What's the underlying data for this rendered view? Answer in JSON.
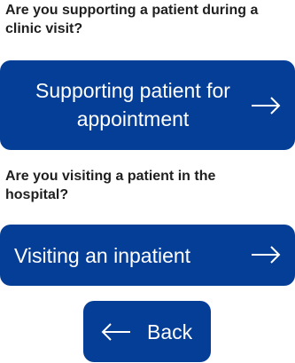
{
  "questions": {
    "clinic": "Are you supporting a patient during a clinic visit?",
    "hospital": "Are you visiting a patient in the hospital?"
  },
  "buttons": {
    "appointment_label": "Supporting patient for appointment",
    "inpatient_label": "Visiting an inpatient",
    "back_label": "Back"
  },
  "icons": {
    "forward": "arrow-right-icon",
    "back": "arrow-left-icon"
  },
  "colors": {
    "button_bg": "#043e96",
    "button_text": "#ffffff",
    "question_text": "#1f1f1f",
    "page_bg": "#ffffff"
  }
}
